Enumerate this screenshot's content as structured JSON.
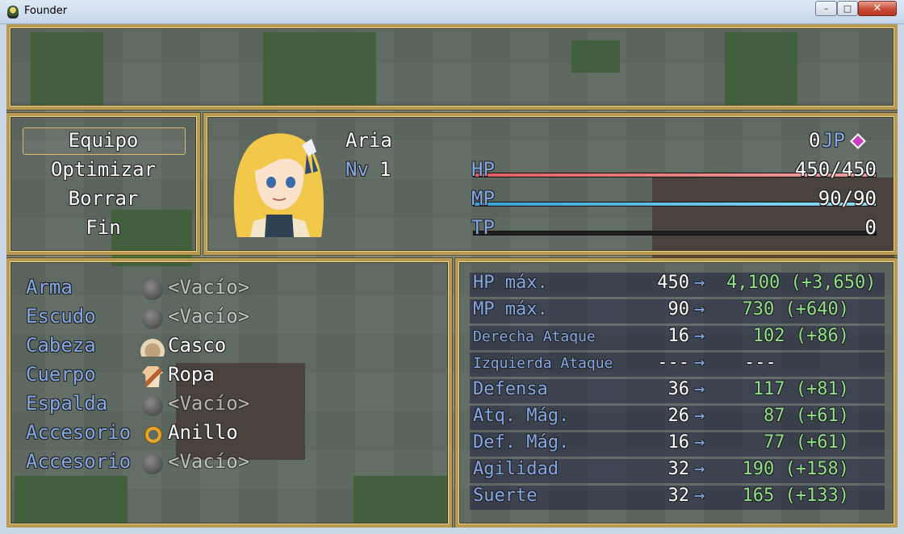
{
  "window": {
    "title": "Founder",
    "minimize": "–",
    "maximize": "□",
    "close": "✕"
  },
  "commands": [
    {
      "label": "Equipo"
    },
    {
      "label": "Optimizar"
    },
    {
      "label": "Borrar"
    },
    {
      "label": "Fin"
    }
  ],
  "actor": {
    "name": "Aria",
    "level_label": "Nv",
    "level": "1",
    "jp": "0",
    "jp_label": "JP",
    "hp_label": "HP",
    "hp": "450/450",
    "hp_rate": 1.0,
    "mp_label": "MP",
    "mp": "90/90",
    "mp_rate": 1.0,
    "tp_label": "TP",
    "tp": "0",
    "tp_rate": 0.0
  },
  "equip_slots": [
    {
      "slot": "Arma",
      "item": "<Vacío>",
      "icon": "empty-slot-icon"
    },
    {
      "slot": "Escudo",
      "item": "<Vacío>",
      "icon": "empty-slot-icon"
    },
    {
      "slot": "Cabeza",
      "item": "Casco",
      "icon": "helmet-icon"
    },
    {
      "slot": "Cuerpo",
      "item": "Ropa",
      "icon": "robe-icon"
    },
    {
      "slot": "Espalda",
      "item": "<Vacío>",
      "icon": "empty-slot-icon"
    },
    {
      "slot": "Accesorio",
      "item": "Anillo",
      "icon": "ring-icon"
    },
    {
      "slot": "Accesorio",
      "item": "<Vacío>",
      "icon": "empty-slot-icon"
    }
  ],
  "stats": [
    {
      "name": "HP máx.",
      "current": "450",
      "arrow": "→",
      "new": "4,100 (+3,650)"
    },
    {
      "name": "MP máx.",
      "current": "90",
      "arrow": "→",
      "new": "730 (+640)"
    },
    {
      "name": "Derecha Ataque",
      "current": "16",
      "arrow": "→",
      "new": "102 (+86)"
    },
    {
      "name": "Izquierda Ataque",
      "current": "---",
      "arrow": "→",
      "new": "---"
    },
    {
      "name": "Defensa",
      "current": "36",
      "arrow": "→",
      "new": "117 (+81)"
    },
    {
      "name": "Atq. Mág.",
      "current": "26",
      "arrow": "→",
      "new": "87 (+61)"
    },
    {
      "name": "Def. Mág.",
      "current": "16",
      "arrow": "→",
      "new": "77 (+61)"
    },
    {
      "name": "Agilidad",
      "current": "32",
      "arrow": "→",
      "new": "190 (+158)"
    },
    {
      "name": "Suerte",
      "current": "32",
      "arrow": "→",
      "new": "165 (+133)"
    }
  ],
  "colors": {
    "system": "#83a8e6",
    "power_up": "#8fe08a",
    "hp_gauge": "#e06060",
    "mp_gauge": "#5cc8f0",
    "jp_icon": "#c93fc2"
  }
}
